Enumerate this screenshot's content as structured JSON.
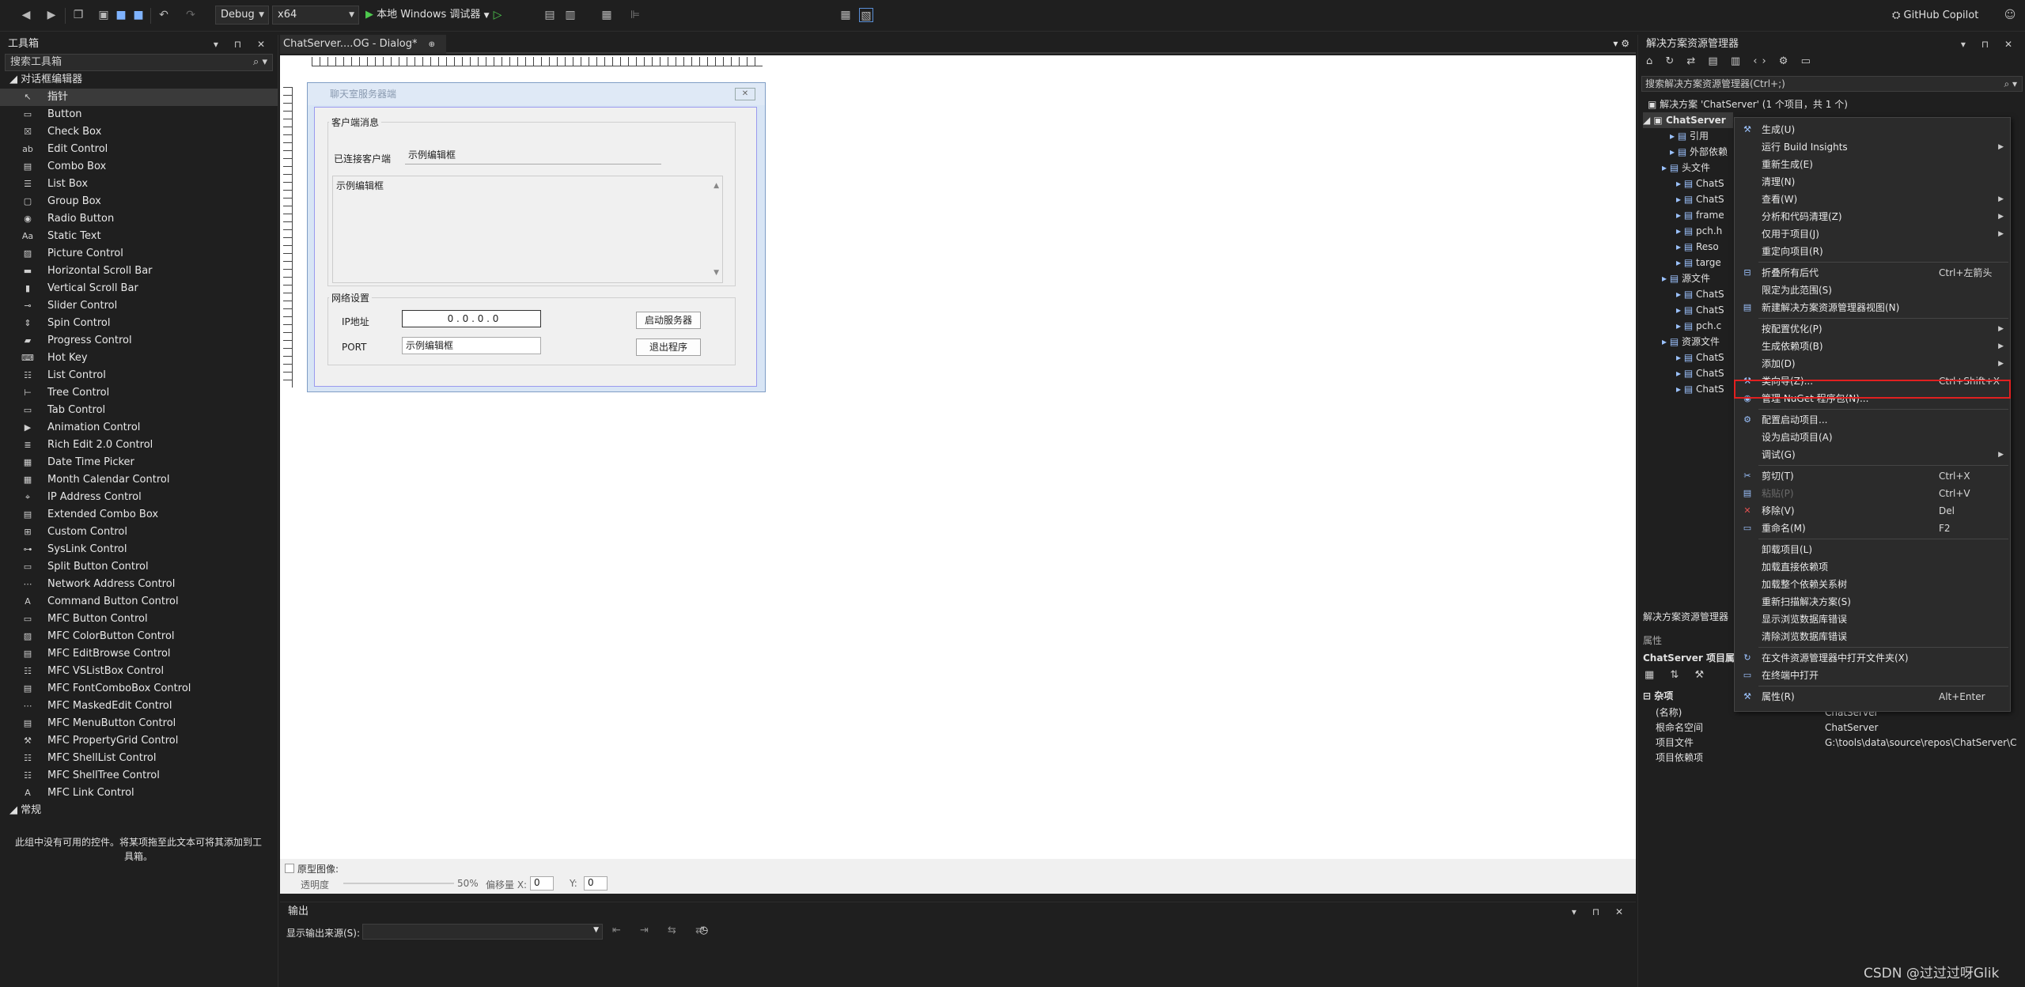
{
  "toolbar": {
    "config": "Debug",
    "platform": "x64",
    "run_label": "本地 Windows 调试器",
    "copilot": "GitHub Copilot"
  },
  "toolbox": {
    "title": "工具箱",
    "search_placeholder": "搜索工具箱",
    "group": "对话框编辑器",
    "items": [
      "指针",
      "Button",
      "Check Box",
      "Edit Control",
      "Combo Box",
      "List Box",
      "Group Box",
      "Radio Button",
      "Static Text",
      "Picture Control",
      "Horizontal Scroll Bar",
      "Vertical Scroll Bar",
      "Slider Control",
      "Spin Control",
      "Progress Control",
      "Hot Key",
      "List Control",
      "Tree Control",
      "Tab Control",
      "Animation Control",
      "Rich Edit 2.0 Control",
      "Date Time Picker",
      "Month Calendar Control",
      "IP Address Control",
      "Extended Combo Box",
      "Custom Control",
      "SysLink Control",
      "Split Button Control",
      "Network Address Control",
      "Command Button Control",
      "MFC Button Control",
      "MFC ColorButton Control",
      "MFC EditBrowse Control",
      "MFC VSListBox Control",
      "MFC FontComboBox Control",
      "MFC MaskedEdit Control",
      "MFC MenuButton Control",
      "MFC PropertyGrid Control",
      "MFC ShellList Control",
      "MFC ShellTree Control",
      "MFC Link Control"
    ],
    "group2": "常规",
    "empty_text": "此组中没有可用的控件。将某项拖至此文本可将其添加到工具箱。"
  },
  "editor": {
    "tab": "ChatServer....OG - Dialog*",
    "dialog": {
      "title": "聊天室服务器端",
      "group1": "客户端消息",
      "connected_label": "已连接客户端",
      "edit_sample": "示例编辑框",
      "list_sample": "示例编辑框",
      "group2": "网络设置",
      "ip_label": "IP地址",
      "ip_value": "0 . 0 . 0 . 0",
      "port_label": "PORT",
      "port_value": "示例编辑框",
      "start_btn": "启动服务器",
      "exit_btn": "退出程序"
    },
    "bottom": {
      "checkbox": "原型图像:",
      "transparency": "透明度",
      "pct": "50%",
      "offset_x": "偏移量 X:",
      "x_val": "0",
      "y_lbl": "Y:",
      "y_val": "0"
    }
  },
  "output": {
    "title": "输出",
    "source_label": "显示输出来源(S):"
  },
  "solution": {
    "title": "解决方案资源管理器",
    "search_placeholder": "搜索解决方案资源管理器(Ctrl+;)",
    "solution_line": "解决方案 'ChatServer' (1 个项目，共 1 个)",
    "project": "ChatServer",
    "tree": [
      "引用",
      "外部依赖",
      "头文件",
      "ChatS",
      "ChatS",
      "frame",
      "pch.h",
      "Reso",
      "targe",
      "源文件",
      "ChatS",
      "ChatS",
      "pch.c",
      "资源文件",
      "ChatS",
      "ChatS",
      "ChatS"
    ],
    "footer": "解决方案资源管理器",
    "props_title": "属性",
    "props_header": "ChatServer 项目属性",
    "props_section": "杂项",
    "props": [
      {
        "k": "(名称)",
        "v": "ChatServer"
      },
      {
        "k": "根命名空间",
        "v": "ChatServer"
      },
      {
        "k": "项目文件",
        "v": "G:\\tools\\data\\source\\repos\\ChatServer\\C"
      },
      {
        "k": "项目依赖项",
        "v": ""
      }
    ]
  },
  "context_menu": {
    "items": [
      {
        "label": "生成(U)",
        "sc": "",
        "sub": false
      },
      {
        "label": "运行 Build Insights",
        "sc": "",
        "sub": true
      },
      {
        "label": "重新生成(E)",
        "sc": "",
        "sub": false
      },
      {
        "label": "清理(N)",
        "sc": "",
        "sub": false
      },
      {
        "label": "查看(W)",
        "sc": "",
        "sub": true
      },
      {
        "label": "分析和代码清理(Z)",
        "sc": "",
        "sub": true
      },
      {
        "label": "仅用于项目(J)",
        "sc": "",
        "sub": true
      },
      {
        "label": "重定向项目(R)",
        "sc": "",
        "sub": false
      },
      {
        "label": "折叠所有后代",
        "sc": "Ctrl+左箭头",
        "sub": false
      },
      {
        "label": "限定为此范围(S)",
        "sc": "",
        "sub": false
      },
      {
        "label": "新建解决方案资源管理器视图(N)",
        "sc": "",
        "sub": false
      },
      {
        "label": "按配置优化(P)",
        "sc": "",
        "sub": true
      },
      {
        "label": "生成依赖项(B)",
        "sc": "",
        "sub": true
      },
      {
        "label": "添加(D)",
        "sc": "",
        "sub": true
      },
      {
        "label": "类向导(Z)...",
        "sc": "Ctrl+Shift+X",
        "sub": false
      },
      {
        "label": "管理 NuGet 程序包(N)...",
        "sc": "",
        "sub": false
      },
      {
        "label": "配置启动项目...",
        "sc": "",
        "sub": false
      },
      {
        "label": "设为启动项目(A)",
        "sc": "",
        "sub": false
      },
      {
        "label": "调试(G)",
        "sc": "",
        "sub": true
      },
      {
        "label": "剪切(T)",
        "sc": "Ctrl+X",
        "sub": false
      },
      {
        "label": "粘贴(P)",
        "sc": "Ctrl+V",
        "sub": false
      },
      {
        "label": "移除(V)",
        "sc": "Del",
        "sub": false
      },
      {
        "label": "重命名(M)",
        "sc": "F2",
        "sub": false
      },
      {
        "label": "卸载项目(L)",
        "sc": "",
        "sub": false
      },
      {
        "label": "加载直接依赖项",
        "sc": "",
        "sub": false
      },
      {
        "label": "加载整个依赖关系树",
        "sc": "",
        "sub": false
      },
      {
        "label": "重新扫描解决方案(S)",
        "sc": "",
        "sub": false
      },
      {
        "label": "显示浏览数据库错误",
        "sc": "",
        "sub": false
      },
      {
        "label": "清除浏览数据库错误",
        "sc": "",
        "sub": false
      },
      {
        "label": "在文件资源管理器中打开文件夹(X)",
        "sc": "",
        "sub": false
      },
      {
        "label": "在终端中打开",
        "sc": "",
        "sub": false
      },
      {
        "label": "属性(R)",
        "sc": "Alt+Enter",
        "sub": false
      }
    ]
  },
  "watermark": "CSDN @过过过呀Glik",
  "colors": {
    "highlight": "#e02020",
    "bg": "#1f1f1f",
    "menu_bg": "#2b2b2b"
  }
}
